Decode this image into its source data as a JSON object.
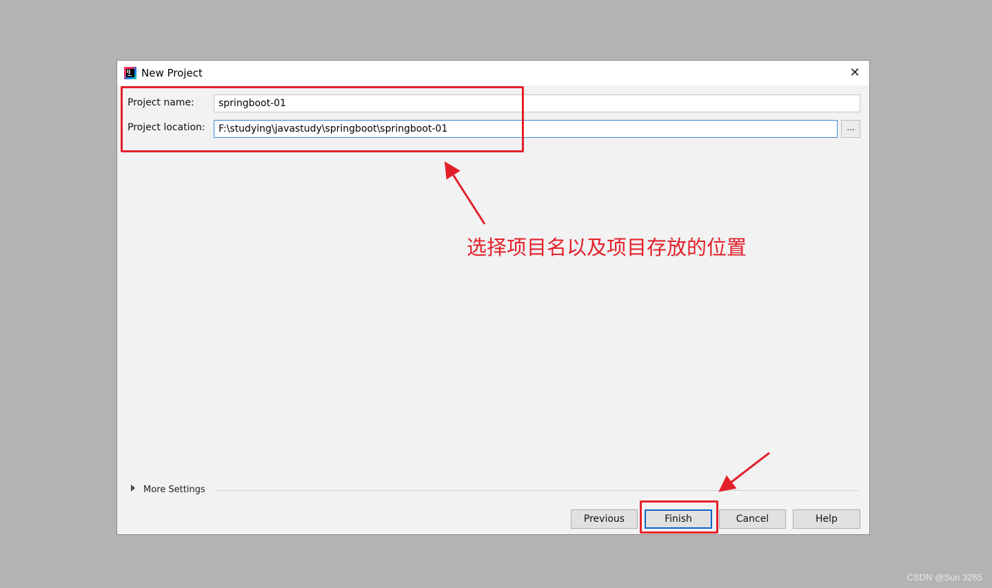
{
  "dialog": {
    "title": "New Project",
    "close_symbol": "✕",
    "app_icon": "intellij-idea-icon"
  },
  "form": {
    "project_name_label": "Project name:",
    "project_name_value": "springboot-01",
    "project_location_label": "Project location:",
    "project_location_value": "F:\\studying\\javastudy\\springboot\\springboot-01",
    "browse_label": "..."
  },
  "more_settings": {
    "label": "More Settings"
  },
  "buttons": {
    "previous": "Previous",
    "finish": "Finish",
    "cancel": "Cancel",
    "help": "Help"
  },
  "annotation": {
    "text": "选择项目名以及项目存放的位置",
    "color": "#e3202a"
  },
  "watermark": "CSDN @Sun 3285"
}
